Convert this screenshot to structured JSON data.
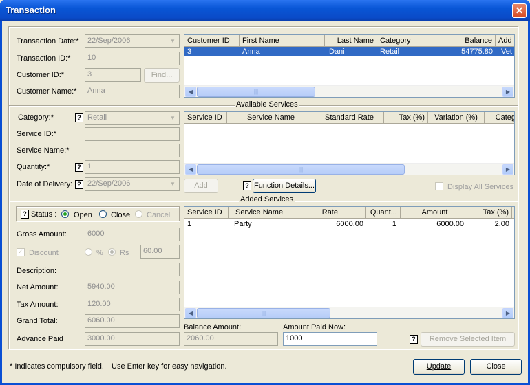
{
  "window": {
    "title": "Transaction"
  },
  "customer_form": {
    "transaction_date_label": "Transaction Date:*",
    "transaction_date": "22/Sep/2006",
    "transaction_id_label": "Transaction ID:*",
    "transaction_id": "10",
    "customer_id_label": "Customer ID:*",
    "customer_id": "3",
    "find_button": "Find...",
    "customer_name_label": "Customer Name:*",
    "customer_name": "Anna"
  },
  "customer_grid": {
    "columns": [
      "Customer ID",
      "First Name",
      "Last Name",
      "Category",
      "Balance",
      "Add"
    ],
    "rows": [
      [
        "3",
        "Anna",
        "Dani",
        "Retail",
        "54775.80",
        "Vet"
      ]
    ]
  },
  "available_services": {
    "section_title": "Available Services",
    "category_label": "Category:*",
    "category": "Retail",
    "service_id_label": "Service ID:*",
    "service_id": "",
    "service_name_label": "Service Name:*",
    "service_name": "",
    "quantity_label": "Quantity:*",
    "quantity": "1",
    "delivery_label": "Date of Delivery:",
    "delivery_date": "22/Sep/2006",
    "add_button": "Add",
    "function_details_button": "Function Details...",
    "display_all_label": "Display All Services",
    "columns": [
      "Service ID",
      "Service Name",
      "Standard Rate",
      "Tax (%)",
      "Variation (%)",
      "Categ"
    ]
  },
  "added_services": {
    "section_title": "Added Services",
    "columns": [
      "Service ID",
      "Service Name",
      "Rate",
      "Quant...",
      "Amount",
      "Tax (%)"
    ],
    "rows": [
      [
        "1",
        "Party",
        "6000.00",
        "1",
        "6000.00",
        "2.00"
      ]
    ],
    "balance_label": "Balance Amount:",
    "balance": "2060.00",
    "paid_now_label": "Amount Paid Now:",
    "paid_now": "1000",
    "remove_button": "Remove Selected Item"
  },
  "billing": {
    "status_label": "Status :",
    "status_open": "Open",
    "status_close": "Close",
    "status_cancel": "Cancel",
    "gross_label": "Gross Amount:",
    "gross": "6000",
    "discount_label": "Discount",
    "pct_label": "%",
    "rs_label": "Rs",
    "discount_value": "60.00",
    "description_label": "Description:",
    "description": "",
    "net_label": "Net Amount:",
    "net": "5940.00",
    "tax_label": "Tax Amount:",
    "tax": "120.00",
    "grand_label": "Grand Total:",
    "grand": "6060.00",
    "advance_label": "Advance Paid",
    "advance": "3000.00"
  },
  "footer": {
    "note": "* Indicates compulsory field.",
    "hint": "Use Enter key for easy navigation.",
    "update_button": "Update",
    "close_button": "Close"
  },
  "icons": {
    "close": "close-icon",
    "help": "help-icon",
    "dropdown": "chevron-down-icon"
  }
}
